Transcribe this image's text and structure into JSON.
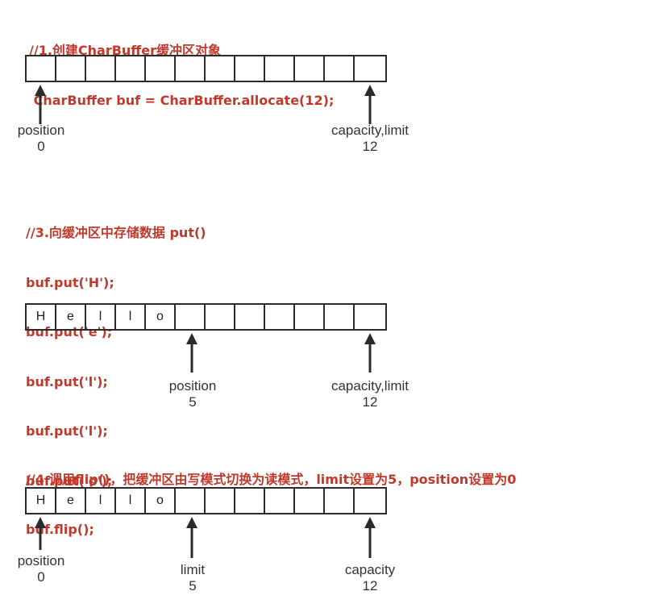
{
  "section1": {
    "code": [
      "//1.创建CharBuffer缓冲区对象",
      " CharBuffer buf = CharBuffer.allocate(12);"
    ],
    "cells": [
      "",
      "",
      "",
      "",
      "",
      "",
      "",
      "",
      "",
      "",
      "",
      ""
    ],
    "pointers": [
      {
        "label": "position",
        "value": "0"
      },
      {
        "label": "capacity,limit",
        "value": "12"
      }
    ]
  },
  "section2": {
    "code": [
      "//3.向缓冲区中存储数据 put()",
      "buf.put('H');",
      "buf.put('e');",
      "buf.put('l');",
      "buf.put('l');",
      "buf.put('o');"
    ],
    "cells": [
      "H",
      "e",
      "l",
      "l",
      "o",
      "",
      "",
      "",
      "",
      "",
      "",
      ""
    ],
    "pointers": [
      {
        "label": "position",
        "value": "5"
      },
      {
        "label": "capacity,limit",
        "value": "12"
      }
    ]
  },
  "section3": {
    "code": [
      "//4.调用flip()，把缓冲区由写模式切换为读模式，limit设置为5，position设置为0",
      "buf.flip();"
    ],
    "cells": [
      "H",
      "e",
      "l",
      "l",
      "o",
      "",
      "",
      "",
      "",
      "",
      "",
      ""
    ],
    "pointers": [
      {
        "label": "position",
        "value": "0"
      },
      {
        "label": "limit",
        "value": "5"
      },
      {
        "label": "capacity",
        "value": "12"
      }
    ]
  },
  "colors": {
    "code": "#c0392b",
    "line": "#2b2b2b"
  }
}
